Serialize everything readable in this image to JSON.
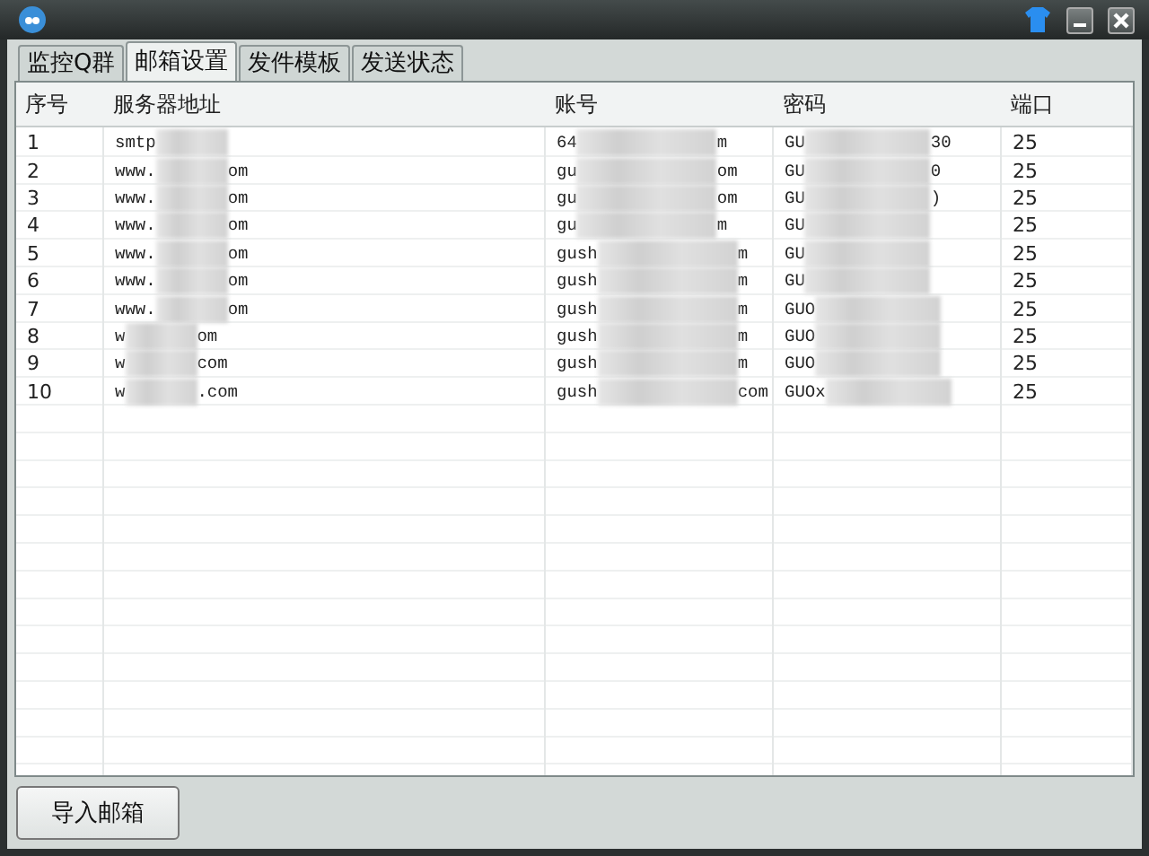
{
  "tabs": [
    {
      "label": "监控Q群",
      "selected": false
    },
    {
      "label": "邮箱设置",
      "selected": true
    },
    {
      "label": "发件模板",
      "selected": false
    },
    {
      "label": "发送状态",
      "selected": false
    }
  ],
  "table": {
    "columns": [
      "序号",
      "服务器地址",
      "账号",
      "密码",
      "端口"
    ],
    "rows": [
      {
        "index": "1",
        "server": [
          "smtp"
        ],
        "account": [
          "64",
          "m"
        ],
        "password": [
          "GU",
          "30"
        ],
        "port": "25"
      },
      {
        "index": "2",
        "server": [
          "www.",
          "om"
        ],
        "account": [
          "gu",
          "om"
        ],
        "password": [
          "GU",
          "0"
        ],
        "port": "25"
      },
      {
        "index": "3",
        "server": [
          "www.",
          "om"
        ],
        "account": [
          "gu",
          "om"
        ],
        "password": [
          "GU",
          ")"
        ],
        "port": "25"
      },
      {
        "index": "4",
        "server": [
          "www.",
          "om"
        ],
        "account": [
          "gu",
          "m"
        ],
        "password": [
          "GU"
        ],
        "port": "25"
      },
      {
        "index": "5",
        "server": [
          "www.",
          "om"
        ],
        "account": [
          "gush",
          "m"
        ],
        "password": [
          "GU"
        ],
        "port": "25"
      },
      {
        "index": "6",
        "server": [
          "www.",
          "om"
        ],
        "account": [
          "gush",
          "m"
        ],
        "password": [
          "GU"
        ],
        "port": "25"
      },
      {
        "index": "7",
        "server": [
          "www.",
          "om"
        ],
        "account": [
          "gush",
          "m"
        ],
        "password": [
          "GUO"
        ],
        "port": "25"
      },
      {
        "index": "8",
        "server": [
          "w",
          "om"
        ],
        "account": [
          "gush",
          "m"
        ],
        "password": [
          "GUO"
        ],
        "port": "25"
      },
      {
        "index": "9",
        "server": [
          "w",
          "com"
        ],
        "account": [
          "gush",
          "m"
        ],
        "password": [
          "GUO"
        ],
        "port": "25"
      },
      {
        "index": "10",
        "server": [
          "w",
          ".com"
        ],
        "account": [
          "gush",
          "com"
        ],
        "password": [
          "GUOx"
        ],
        "port": "25"
      }
    ]
  },
  "buttons": [
    "导入邮箱"
  ]
}
